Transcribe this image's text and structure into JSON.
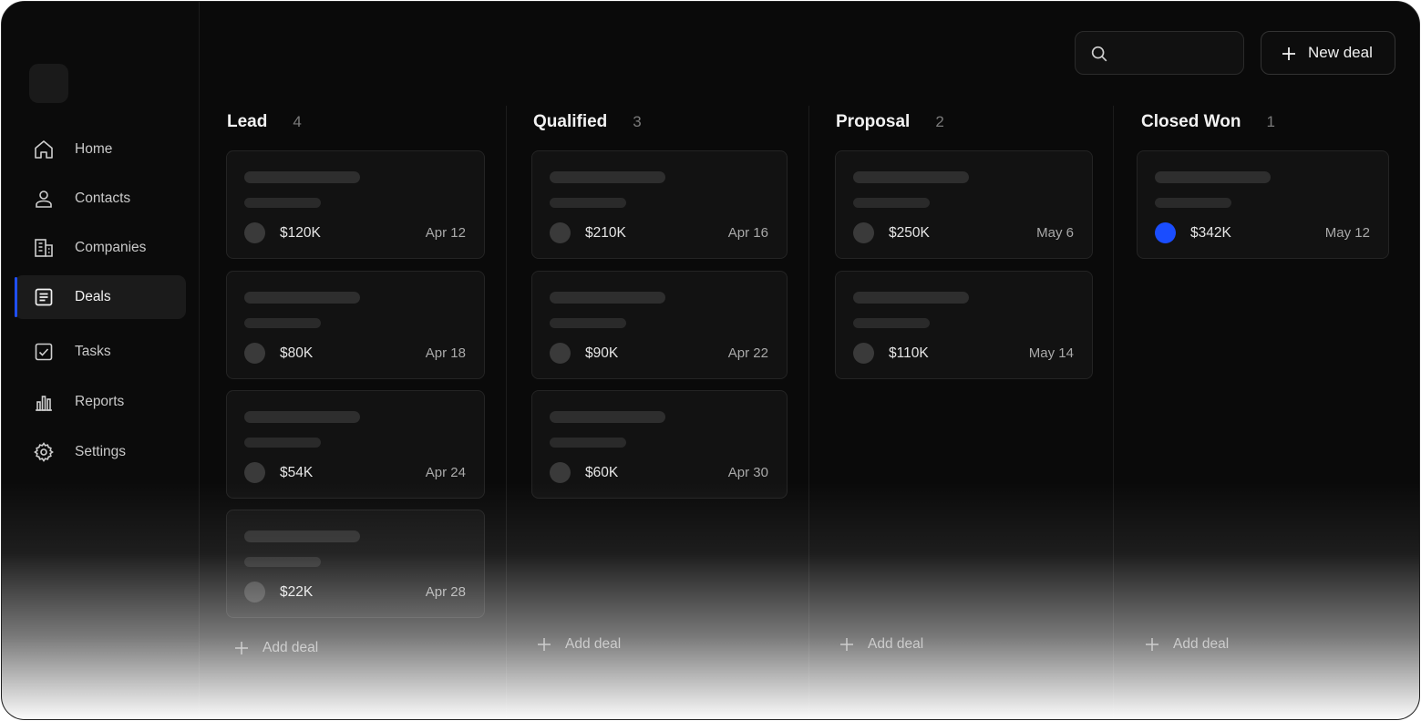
{
  "app": {
    "accent_color": "#1f4fff"
  },
  "sidebar": {
    "items": [
      {
        "label": "Home",
        "icon": "home-icon"
      },
      {
        "label": "Contacts",
        "icon": "user-icon"
      },
      {
        "label": "Companies",
        "icon": "building-icon"
      },
      {
        "label": "Deals",
        "icon": "document-icon",
        "active": true
      },
      {
        "label": "Tasks",
        "icon": "checkbox-icon"
      },
      {
        "label": "Reports",
        "icon": "bar-chart-icon"
      },
      {
        "label": "Settings",
        "icon": "gear-icon"
      }
    ]
  },
  "header": {
    "search_placeholder": "",
    "new_deal_label": "New deal"
  },
  "board": {
    "add_deal_label": "Add deal",
    "columns": [
      {
        "title": "Lead",
        "count": "4",
        "cards": [
          {
            "amount": "$120K",
            "date": "Apr 12"
          },
          {
            "amount": "$80K",
            "date": "Apr 18"
          },
          {
            "amount": "$54K",
            "date": "Apr 24"
          },
          {
            "amount": "$22K",
            "date": "Apr 28"
          }
        ]
      },
      {
        "title": "Qualified",
        "count": "3",
        "cards": [
          {
            "amount": "$210K",
            "date": "Apr 16"
          },
          {
            "amount": "$90K",
            "date": "Apr 22"
          },
          {
            "amount": "$60K",
            "date": "Apr 30"
          }
        ]
      },
      {
        "title": "Proposal",
        "count": "2",
        "cards": [
          {
            "amount": "$250K",
            "date": "May 6"
          },
          {
            "amount": "$110K",
            "date": "May 14"
          }
        ]
      },
      {
        "title": "Closed Won",
        "count": "1",
        "cards": [
          {
            "amount": "$342K",
            "date": "May 12",
            "avatar_color": "#1a4dff"
          }
        ]
      }
    ]
  }
}
